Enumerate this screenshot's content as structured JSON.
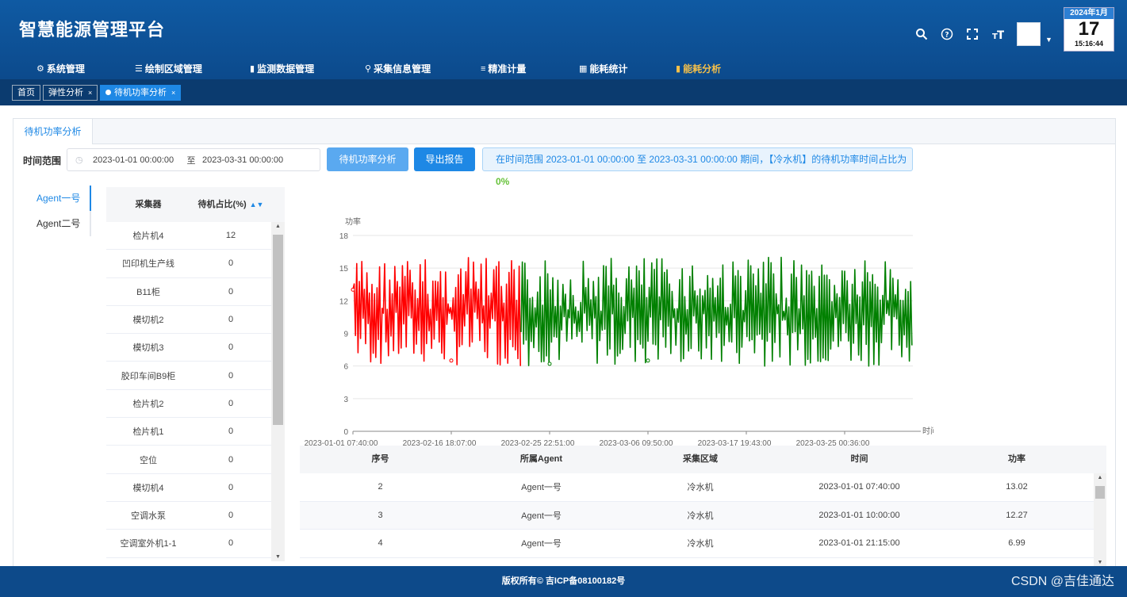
{
  "app": {
    "title": "智慧能源管理平台"
  },
  "calendar": {
    "month": "2024年1月",
    "day": "17",
    "time": "15:16:44"
  },
  "nav": {
    "items": [
      {
        "label": "系统管理",
        "icon": "gear-icon"
      },
      {
        "label": "绘制区域管理",
        "icon": "list-icon"
      },
      {
        "label": "监测数据管理",
        "icon": "bar-chart-icon"
      },
      {
        "label": "采集信息管理",
        "icon": "plug-icon"
      },
      {
        "label": "精准计量",
        "icon": "sliders-icon"
      },
      {
        "label": "能耗统计",
        "icon": "grid-icon"
      },
      {
        "label": "能耗分析",
        "icon": "bar-chart-icon",
        "active": true
      }
    ]
  },
  "tabs": [
    {
      "label": "首页"
    },
    {
      "label": "弹性分析",
      "close": "×"
    },
    {
      "label": "待机功率分析",
      "close": "×",
      "active": true
    }
  ],
  "panel": {
    "tab": "待机功率分析"
  },
  "filter": {
    "label": "时间范围",
    "start": "2023-01-01 00:00:00",
    "separator": "至",
    "end": "2023-03-31 00:00:00",
    "analyze_button": "待机功率分析",
    "export_button": "导出报告",
    "info_text": "在时间范围 2023-01-01 00:00:00 至 2023-03-31 00:00:00 期间，【冷水机】的待机功率时间占比为 ",
    "info_pct": "0%"
  },
  "agents": [
    {
      "label": "Agent一号",
      "active": true
    },
    {
      "label": "Agent二号"
    }
  ],
  "collector_table": {
    "headers": [
      "采集器",
      "待机占比(%)"
    ],
    "rows": [
      [
        "检片机4",
        "12"
      ],
      [
        "凹印机生产线",
        "0"
      ],
      [
        "B11柜",
        "0"
      ],
      [
        "模切机2",
        "0"
      ],
      [
        "模切机3",
        "0"
      ],
      [
        "胶印车间B9柜",
        "0"
      ],
      [
        "检片机2",
        "0"
      ],
      [
        "检片机1",
        "0"
      ],
      [
        "空位",
        "0"
      ],
      [
        "模切机4",
        "0"
      ],
      [
        "空调水泵",
        "0"
      ],
      [
        "空调室外机1-1",
        "0"
      ]
    ]
  },
  "chart_data": {
    "type": "line",
    "ylabel": "功率",
    "xlabel": "时间",
    "ylim": [
      0,
      18
    ],
    "yticks": [
      0,
      3,
      6,
      9,
      12,
      15,
      18
    ],
    "xtick_labels": [
      "2023-01-01 07:40:00",
      "2023-02-16 18:07:00",
      "2023-02-25 22:51:00",
      "2023-03-06 09:50:00",
      "2023-03-17 19:43:00",
      "2023-03-25 00:36:00"
    ],
    "series": [
      {
        "color": "#ff0000",
        "x_range": [
          "2023-01-01 07:40:00",
          "2023-02-25 22:51:00"
        ],
        "min": 6,
        "max": 16,
        "first_value": 13.02
      },
      {
        "color": "#008000",
        "x_range": [
          "2023-02-25 22:51:00",
          "2023-03-31 00:00:00"
        ],
        "min": 6,
        "max": 16
      }
    ],
    "grid": true
  },
  "data_table": {
    "headers": [
      "序号",
      "所属Agent",
      "采集区域",
      "时间",
      "功率"
    ],
    "rows": [
      [
        "2",
        "Agent一号",
        "冷水机",
        "2023-01-01 07:40:00",
        "13.02"
      ],
      [
        "3",
        "Agent一号",
        "冷水机",
        "2023-01-01 10:00:00",
        "12.27"
      ],
      [
        "4",
        "Agent一号",
        "冷水机",
        "2023-01-01 21:15:00",
        "6.99"
      ]
    ]
  },
  "footer": {
    "text": "版权所有© 吉ICP备08100182号",
    "watermark": "CSDN @吉佳通达"
  }
}
